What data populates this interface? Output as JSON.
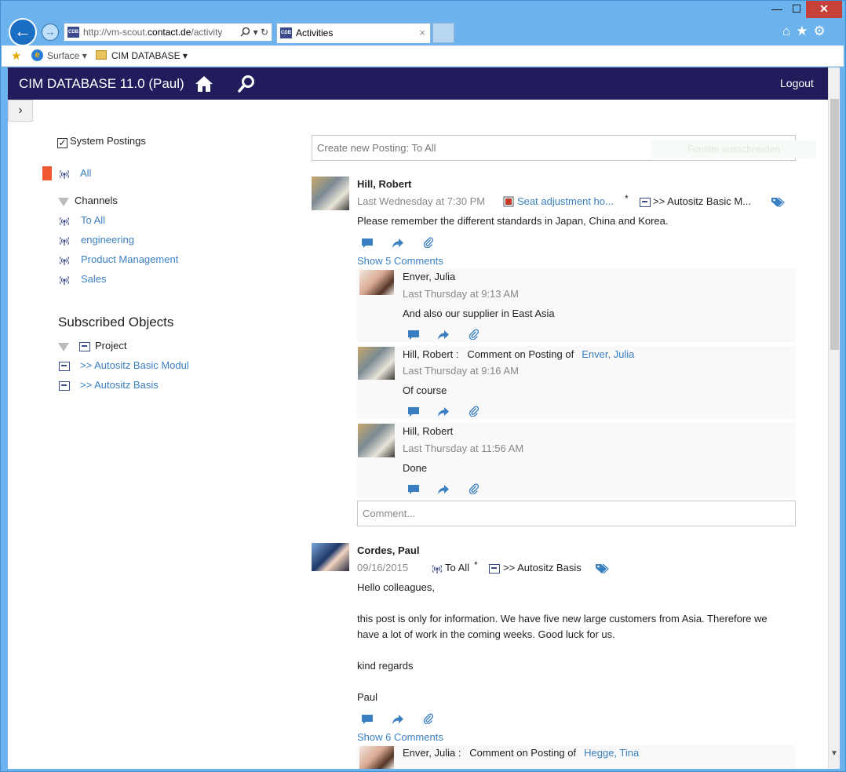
{
  "browser": {
    "url_prefix": "http://vm-scout.",
    "url_domain": "contact.de",
    "url_path": "/activity",
    "tab_title": "Activities",
    "tab_close": "×",
    "favorites": {
      "surface": "Surface ▾",
      "cim": "CIM DATABASE ▾"
    },
    "window": {
      "minimize": "—",
      "maximize": "☐",
      "close": "✕"
    }
  },
  "app": {
    "title": "CIM DATABASE 11.0 (Paul)",
    "logout": "Logout",
    "toggle": "›"
  },
  "sidebar": {
    "system_postings": "System Postings",
    "all": "All",
    "channels_header": "Channels",
    "channels": [
      "To All",
      "engineering",
      "Product Management",
      "Sales"
    ],
    "subscribed_title": "Subscribed Objects",
    "project_header": "Project",
    "objects": [
      ">> Autositz Basic Modul",
      ">> Autositz Basis"
    ]
  },
  "feed": {
    "new_posting_placeholder": "Create new Posting: To All",
    "ghost_button": "Fenster ausschneiden",
    "comment_placeholder": "Comment...",
    "posts": [
      {
        "author": "Hill, Robert",
        "time": "Last Wednesday at 7:30 PM",
        "ref1": "Seat adjustment ho...",
        "ref2": ">> Autositz Basic M...",
        "asterisk": "*",
        "text": "Please remember the different standards in Japan, China and Korea.",
        "show_comments": "Show 5 Comments",
        "comments": [
          {
            "author": "Enver, Julia",
            "prefix": "",
            "target": "",
            "time": "Last Thursday at 9:13 AM",
            "text": "And also our supplier in East Asia"
          },
          {
            "author": "Hill, Robert",
            "prefix": " :   Comment on Posting of",
            "target": "Enver, Julia",
            "time": "Last Thursday at 9:16 AM",
            "text": "Of course"
          },
          {
            "author": "Hill, Robert",
            "prefix": "",
            "target": "",
            "time": "Last Thursday at 11:56 AM",
            "text": "Done"
          }
        ]
      },
      {
        "author": "Cordes, Paul",
        "time": "09/16/2015",
        "ref1": "To All",
        "ref2": ">> Autositz Basis",
        "asterisk": "*",
        "lines": [
          "Hello colleagues,",
          "this post is only for information. We have five new large customers from Asia.  Therefore we",
          "have a lot of work in the coming weeks. Good luck for us.",
          "kind regards",
          "Paul"
        ],
        "show_comments": "Show 6 Comments",
        "comments": [
          {
            "author": "Enver, Julia",
            "prefix": " :   Comment on Posting of",
            "target": "Hegge, Tina"
          }
        ]
      }
    ]
  },
  "colors": {
    "appbar": "#211d5c",
    "link": "#3a7fc1",
    "accent": "#ef5a32"
  }
}
